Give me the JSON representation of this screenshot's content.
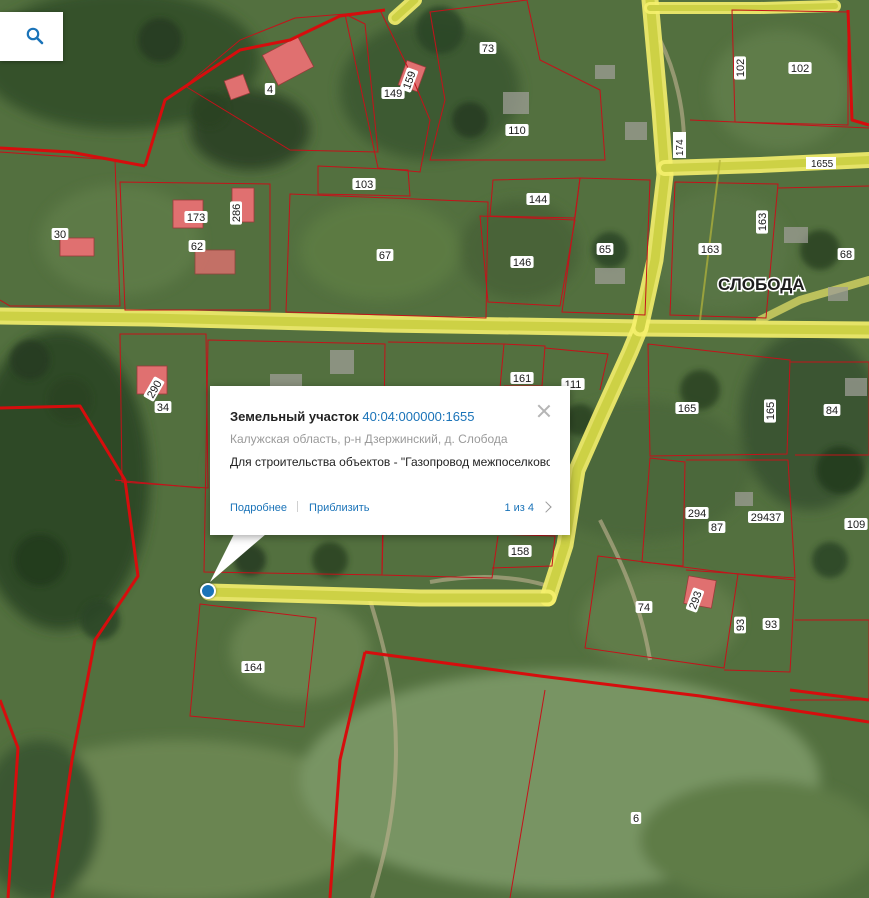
{
  "map": {
    "place_name": "СЛОБОДА",
    "road_badge": "1655",
    "road_badge_vertical": "174",
    "plot_numbers": [
      "4",
      "73",
      "159",
      "149",
      "110",
      "102",
      "102",
      "103",
      "144",
      "173",
      "286",
      "62",
      "30",
      "67",
      "146",
      "65",
      "163",
      "163",
      "68",
      "290",
      "34",
      "161",
      "111",
      "165",
      "165",
      "84",
      "294",
      "87",
      "29437",
      "109",
      "158",
      "74",
      "293",
      "93",
      "93",
      "164",
      "6"
    ],
    "colors": {
      "parcel_border": "#c4121a",
      "district_border": "#d60d0d",
      "road_fill": "#d7d64a",
      "road_halo": "#f3ef6c",
      "building": "#e07070",
      "accent": "#1a73b8"
    }
  },
  "search": {
    "icon": "search-icon"
  },
  "popup": {
    "type": "Земельный участок",
    "cadastral_number": "40:04:000000:1655",
    "address": "Калужская область, р-н Дзержинский, д. Слобода",
    "description": "Для строительства объектов - \"Газопровод межпоселкового",
    "details_link": "Подробнее",
    "zoom_link": "Приблизить",
    "pager": "1 из 4",
    "close_icon": "close-icon",
    "next_icon": "chevron-right-icon"
  }
}
